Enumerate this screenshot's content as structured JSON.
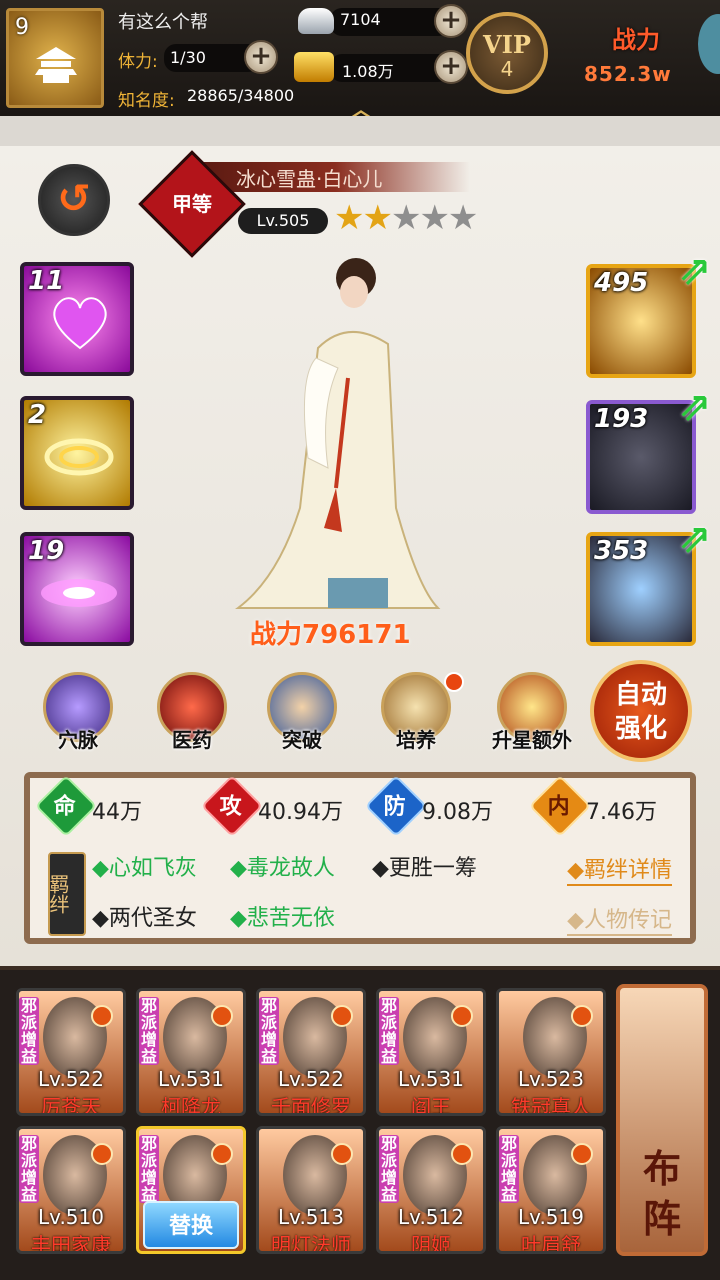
{
  "top": {
    "guild_level": "9",
    "guild_name": "有这么个帮",
    "stamina_label": "体力:",
    "stamina_value": "1/30",
    "fame_label": "知名度:",
    "fame_value": "28865/34800",
    "silver": "7104",
    "gold": "1.08万",
    "vip_label": "VIP",
    "vip_level": "4",
    "power_label": "战力",
    "power_value": "852.3w",
    "plus": "+",
    "caret": "︿"
  },
  "hero": {
    "back": "↺",
    "grade": "甲等",
    "name": "冰心雪蛊·白心儿",
    "level": "Lv.505",
    "stars_on": "★★",
    "stars_off": "★★★",
    "power": "战力796171",
    "skills": [
      "11",
      "2",
      "19"
    ],
    "equips": [
      "495",
      "193",
      "353"
    ]
  },
  "menu": {
    "items": [
      "穴脉",
      "医药",
      "突破",
      "培养",
      "升星额外"
    ],
    "auto_line1": "自动",
    "auto_line2": "强化"
  },
  "stats": {
    "hp_icon": "命",
    "hp": "44万",
    "atk_icon": "攻",
    "atk": "40.94万",
    "def_icon": "防",
    "def": "9.08万",
    "inner_icon": "内",
    "inner": "7.46万",
    "bond_tag": "羁绊",
    "bonds": [
      {
        "text": "◆心如飞灰",
        "color": "green"
      },
      {
        "text": "◆毒龙故人",
        "color": "green"
      },
      {
        "text": "◆更胜一筹",
        "color": "dark"
      },
      {
        "text": "◆两代圣女",
        "color": "dark"
      },
      {
        "text": "◆悲苦无依",
        "color": "green"
      }
    ],
    "bond_detail": "◆羁绊详情",
    "biography": "◆人物传记"
  },
  "roster": {
    "tag": "邪派增益",
    "cards": [
      {
        "lv": "Lv.522",
        "name": "厉苍天"
      },
      {
        "lv": "Lv.531",
        "name": "柯降龙"
      },
      {
        "lv": "Lv.522",
        "name": "千面修罗"
      },
      {
        "lv": "Lv.531",
        "name": "阎王"
      },
      {
        "lv": "Lv.523",
        "name": "铁冠真人"
      },
      {
        "lv": "Lv.510",
        "name": "丰田家康"
      },
      {
        "lv": "",
        "name": ""
      },
      {
        "lv": "Lv.513",
        "name": "明灯法师"
      },
      {
        "lv": "Lv.512",
        "name": "阴姬"
      },
      {
        "lv": "Lv.519",
        "name": "叶眉舒"
      }
    ],
    "swap": "替换",
    "formation1": "布",
    "formation2": "阵"
  },
  "colors": {
    "accent": "#e3a416",
    "power": "#ff5e1a",
    "bond_green": "#22b04a"
  }
}
